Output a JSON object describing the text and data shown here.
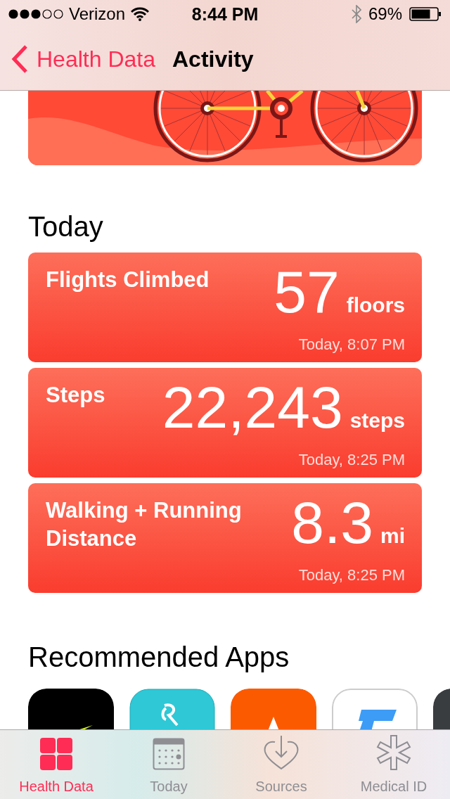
{
  "status_bar": {
    "carrier": "Verizon",
    "time": "8:44 PM",
    "battery": "69%"
  },
  "nav_bar": {
    "back": "Health Data",
    "title": "Activity"
  },
  "today": {
    "heading": "Today",
    "cards": [
      {
        "title": "Flights Climbed",
        "value": "57",
        "unit": "floors",
        "time": "Today, 8:07 PM"
      },
      {
        "title": "Steps",
        "value": "22,243",
        "unit": "steps",
        "time": "Today, 8:25 PM"
      },
      {
        "title": "Walking + Running Distance",
        "value": "8.3",
        "unit": "mi",
        "time": "Today, 8:25 PM"
      }
    ]
  },
  "recommended": {
    "heading": "Recommended Apps",
    "apps": [
      {
        "kind": "swoosh"
      },
      {
        "kind": "script"
      },
      {
        "kind": "peak"
      },
      {
        "kind": "bolt"
      },
      {
        "kind": "dark"
      }
    ]
  },
  "tab_bar": [
    {
      "label": "Health Data",
      "kind": "grid",
      "selected": true
    },
    {
      "label": "Today",
      "kind": "calendar",
      "selected": false
    },
    {
      "label": "Sources",
      "kind": "heart",
      "selected": false
    },
    {
      "label": "Medical ID",
      "kind": "asterisk",
      "selected": false
    }
  ]
}
